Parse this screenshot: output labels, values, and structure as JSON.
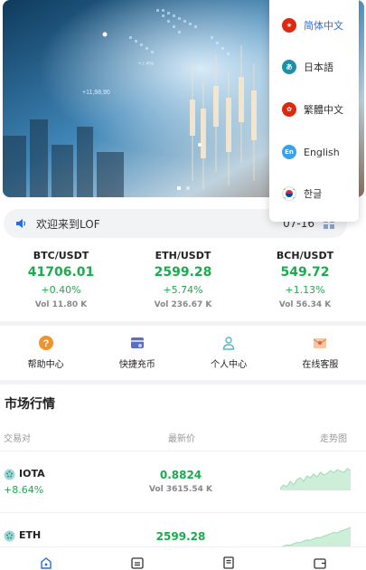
{
  "banner": {
    "active_slide": 1,
    "slide_count": 2,
    "overlay_texts": [
      "+11,98,90",
      "+7.4%"
    ]
  },
  "notice": {
    "text": "欢迎来到LOF",
    "date": "07-16"
  },
  "tickers": [
    {
      "pair": "BTC/USDT",
      "price": "41706.01",
      "change": "+0.40%",
      "vol": "Vol 11.80 K"
    },
    {
      "pair": "ETH/USDT",
      "price": "2599.28",
      "change": "+5.74%",
      "vol": "Vol 236.67 K"
    },
    {
      "pair": "BCH/USDT",
      "price": "549.72",
      "change": "+1.13%",
      "vol": "Vol 56.34 K"
    }
  ],
  "quick_menu": [
    {
      "label": "帮助中心",
      "icon": "help-icon"
    },
    {
      "label": "快捷充币",
      "icon": "deposit-icon"
    },
    {
      "label": "个人中心",
      "icon": "user-icon"
    },
    {
      "label": "在线客服",
      "icon": "customer-service-icon"
    }
  ],
  "market": {
    "title": "市场行情",
    "headers": {
      "pair": "交易对",
      "price": "最新价",
      "trend": "走势图"
    },
    "rows": [
      {
        "name": "IOTA",
        "change": "+8.64%",
        "price": "0.8824",
        "vol": "Vol 3615.54 K",
        "trend": [
          12,
          13,
          12.5,
          14,
          13,
          14.5,
          15,
          14,
          15.5,
          15,
          16,
          15.2,
          16.5,
          15.8,
          16.2,
          17,
          16.4,
          17.2,
          16.8,
          16.5,
          17.5,
          17
        ]
      },
      {
        "name": "ETH",
        "change": "",
        "price": "2599.28",
        "vol": "",
        "trend": [
          10,
          10.5,
          11,
          10.8,
          11.5,
          12,
          11.8,
          12.5,
          13,
          12.8,
          13.5,
          14,
          13.8,
          14.5,
          15,
          15.5,
          16,
          15.8,
          16.5,
          17,
          17.5,
          18
        ]
      }
    ]
  },
  "tabbar": [
    {
      "icon": "home-icon",
      "active": true
    },
    {
      "icon": "market-icon",
      "active": false
    },
    {
      "icon": "orders-icon",
      "active": false
    },
    {
      "icon": "wallet-icon",
      "active": false
    }
  ],
  "language_menu": {
    "items": [
      {
        "label": "简体中文",
        "flag": "china-flag-icon",
        "color": "#de2910",
        "active": true
      },
      {
        "label": "日本語",
        "flag": "japan-icon",
        "color": "#1f8fa8",
        "active": false
      },
      {
        "label": "繁體中文",
        "flag": "hongkong-flag-icon",
        "color": "#de2910",
        "active": false
      },
      {
        "label": "English",
        "flag": "english-icon",
        "color": "#3aa3e8",
        "active": false
      },
      {
        "label": "한글",
        "flag": "korea-flag-icon",
        "color": "#ffffff",
        "active": false
      }
    ]
  },
  "colors": {
    "up": "#1bab4c",
    "accent": "#2b6de0"
  }
}
